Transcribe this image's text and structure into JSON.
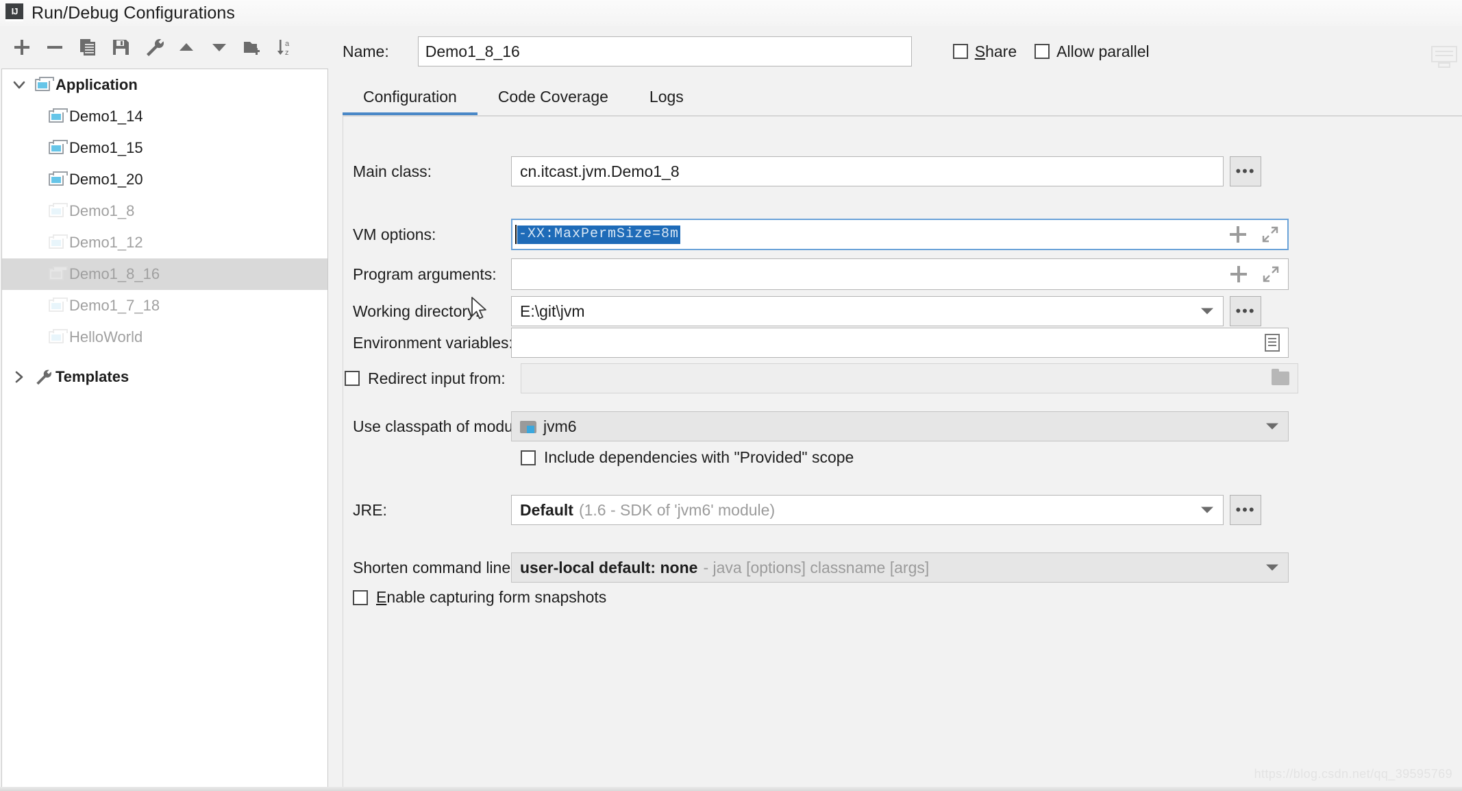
{
  "window": {
    "title": "Run/Debug Configurations",
    "logo_text": "IJ"
  },
  "toolbar": {
    "items": [
      {
        "name": "add-button",
        "icon": "plus-icon",
        "label": "+"
      },
      {
        "name": "remove-button",
        "icon": "minus-icon",
        "label": "−"
      },
      {
        "name": "copy-button",
        "icon": "copy-icon",
        "label": "Copy Configuration"
      },
      {
        "name": "save-button",
        "icon": "save-icon",
        "label": "Save Configuration"
      },
      {
        "name": "edit-templates-button",
        "icon": "wrench-icon",
        "label": "Edit Templates"
      },
      {
        "name": "move-up-button",
        "icon": "triangle-up-icon",
        "label": "Move Up"
      },
      {
        "name": "move-down-button",
        "icon": "triangle-down-icon",
        "label": "Move Down"
      },
      {
        "name": "create-folder-button",
        "icon": "folder-add-icon",
        "label": "Create New Folder"
      },
      {
        "name": "sort-button",
        "icon": "sort-az-icon",
        "label": "Sort Configurations"
      }
    ]
  },
  "tree": {
    "root": {
      "label": "Application",
      "expanded": true,
      "icon": "application-icon"
    },
    "children": [
      {
        "label": "Demo1_14",
        "state": "normal",
        "icon": "application-icon"
      },
      {
        "label": "Demo1_15",
        "state": "normal",
        "icon": "application-icon"
      },
      {
        "label": "Demo1_20",
        "state": "normal",
        "icon": "application-icon"
      },
      {
        "label": "Demo1_8",
        "state": "dim",
        "icon": "application-icon"
      },
      {
        "label": "Demo1_12",
        "state": "dim",
        "icon": "application-icon"
      },
      {
        "label": "Demo1_8_16",
        "state": "selected",
        "icon": "application-icon"
      },
      {
        "label": "Demo1_7_18",
        "state": "dim",
        "icon": "application-icon"
      },
      {
        "label": "HelloWorld",
        "state": "dim",
        "icon": "application-icon"
      }
    ],
    "templates": {
      "label": "Templates",
      "expanded": false,
      "icon": "wrench-icon"
    }
  },
  "header": {
    "name_label": "Name:",
    "name_value": "Demo1_8_16",
    "share_label_underlined": "S",
    "share_label_rest": "hare",
    "share_checked": false,
    "parallel_label": "Allow parallel",
    "parallel_checked": false
  },
  "tabs": [
    {
      "label": "Configuration",
      "active": true
    },
    {
      "label": "Code Coverage",
      "active": false
    },
    {
      "label": "Logs",
      "active": false
    }
  ],
  "form": {
    "main_class": {
      "label": "Main class:",
      "value": "cn.itcast.jvm.Demo1_8",
      "browse_label": "•••"
    },
    "vm_options": {
      "label": "VM options:",
      "value": "-XX:MaxPermSize=8m",
      "selected": true,
      "expand_icon": "expand-icon",
      "add_icon": "plus-icon"
    },
    "program_arguments": {
      "label": "Program arguments:",
      "value": "",
      "expand_icon": "expand-icon",
      "add_icon": "plus-icon"
    },
    "working_directory": {
      "label": "Working directory:",
      "value": "E:\\git\\jvm",
      "browse_label": "•••"
    },
    "environment_variables": {
      "label": "Environment variables:",
      "value": "",
      "browse_icon": "document-icon"
    },
    "redirect_input": {
      "label": "Redirect input from:",
      "checked": false,
      "value": "",
      "browse_icon": "folder-icon"
    },
    "classpath_module": {
      "label": "Use classpath of module:",
      "value": "jvm6",
      "icon": "module-icon"
    },
    "include_provided": {
      "label": "Include dependencies with \"Provided\" scope",
      "checked": false
    },
    "jre": {
      "label": "JRE:",
      "value_bold": "Default",
      "value_gray": "(1.6 - SDK of 'jvm6' module)",
      "browse_label": "•••"
    },
    "shorten_command_line": {
      "label": "Shorten command line:",
      "value_bold": "user-local default: none",
      "value_gray": "- java [options] classname [args]"
    },
    "capture_snapshots": {
      "label_underlined": "E",
      "label_rest": "nable capturing form snapshots",
      "checked": false
    }
  },
  "watermark": {
    "bottom": "https://blog.csdn.net/qq_39595769",
    "mid": ""
  },
  "colors": {
    "accent": "#4a88c7",
    "selection": "#1e6bb8",
    "tree_selected": "#d9d9d9",
    "panel_bg": "#f2f2f2"
  }
}
